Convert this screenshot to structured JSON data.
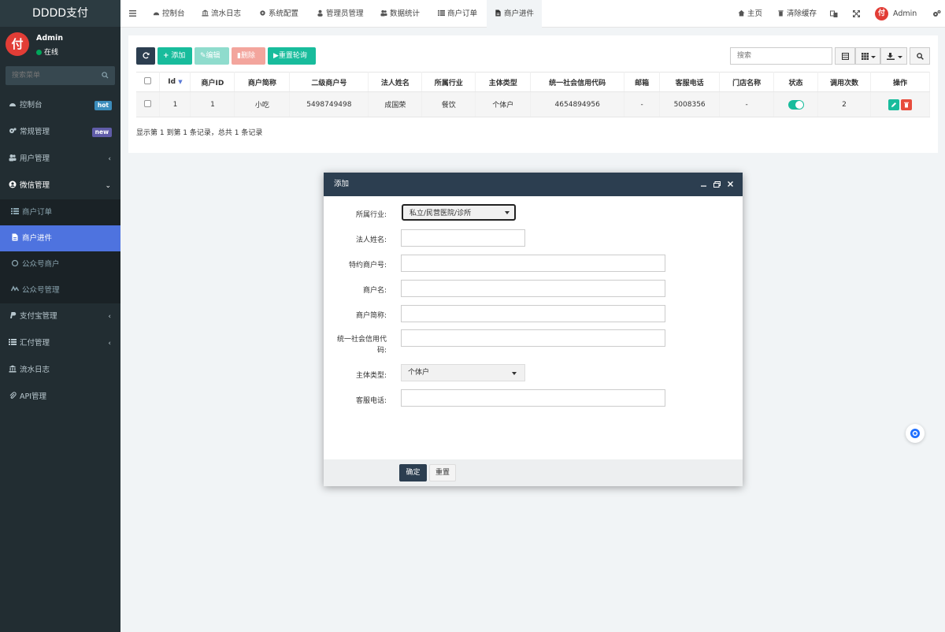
{
  "app": {
    "brand": "DDDD支付"
  },
  "user": {
    "name": "Admin",
    "status": "在线",
    "avatar_text": "付"
  },
  "sidebar": {
    "search_placeholder": "搜索菜单",
    "items": [
      {
        "label": "控制台",
        "icon": "dashboard-icon",
        "badge": "hot",
        "badge_color": "#3c8dbc"
      },
      {
        "label": "常规管理",
        "icon": "cogs-icon",
        "badge": "new",
        "badge_color": "#605ca8"
      },
      {
        "label": "用户管理",
        "icon": "users-icon",
        "chevron": "‹"
      },
      {
        "label": "微信管理",
        "icon": "user-circle-icon",
        "chevron": "⌄"
      },
      {
        "label": "商户订单",
        "icon": "list-icon"
      },
      {
        "label": "商户进件",
        "icon": "file-icon"
      },
      {
        "label": "公众号商户",
        "icon": "circle-icon"
      },
      {
        "label": "公众号管理",
        "icon": "wechat-icon"
      },
      {
        "label": "支付宝管理",
        "icon": "paypal-icon",
        "chevron": "‹"
      },
      {
        "label": "汇付管理",
        "icon": "list-icon",
        "chevron": "‹"
      },
      {
        "label": "流水日志",
        "icon": "bank-icon"
      },
      {
        "label": "API管理",
        "icon": "paperclip-icon"
      }
    ]
  },
  "topbar": {
    "tabs": [
      {
        "label": "控制台",
        "icon": "dashboard-icon"
      },
      {
        "label": "流水日志",
        "icon": "bank-icon"
      },
      {
        "label": "系统配置",
        "icon": "cog-icon"
      },
      {
        "label": "管理员管理",
        "icon": "user-icon"
      },
      {
        "label": "数据统计",
        "icon": "users-icon"
      },
      {
        "label": "商户订单",
        "icon": "list-icon"
      },
      {
        "label": "商户进件",
        "icon": "file-icon"
      }
    ],
    "home": "主页",
    "clear_cache": "清除缓存",
    "admin": "Admin"
  },
  "toolbar": {
    "add": "添加",
    "edit": "编辑",
    "delete": "删除",
    "reset_poll": "重置轮询",
    "search_placeholder": "搜索"
  },
  "table": {
    "headers": [
      "Id",
      "商户ID",
      "商户简称",
      "二级商户号",
      "法人姓名",
      "所属行业",
      "主体类型",
      "统一社会信用代码",
      "邮箱",
      "客服电话",
      "门店名称",
      "状态",
      "调用次数",
      "操作"
    ],
    "rows": [
      {
        "id": "1",
        "merchant_id": "1",
        "short_name": "小吃",
        "sub_mch_no": "5498749498",
        "legal_name": "成国荣",
        "industry": "餐饮",
        "entity_type": "个体户",
        "credit_code": "4654894956",
        "email": "-",
        "phone": "5008356",
        "store": "-",
        "status_on": true,
        "calls": "2"
      }
    ],
    "summary": "显示第 1 到第 1 条记录，总共 1 条记录"
  },
  "modal": {
    "title": "添加",
    "fields": {
      "industry_label": "所属行业:",
      "industry_value": "私立/民营医院/诊所",
      "legal_label": "法人姓名:",
      "special_no_label": "特约商户号:",
      "merchant_name_label": "商户名:",
      "short_name_label": "商户简称:",
      "credit_label_1": "统一社会信用代",
      "credit_label_2": "码:",
      "entity_label": "主体类型:",
      "entity_value": "个体户",
      "phone_label": "客服电话:"
    },
    "ok": "确定",
    "reset": "重置"
  },
  "colors": {
    "sidebar_bg": "#222d32",
    "active": "#4e73df",
    "success": "#18bc9c",
    "danger": "#e74c3c",
    "dark_btn": "#2c3e50"
  }
}
